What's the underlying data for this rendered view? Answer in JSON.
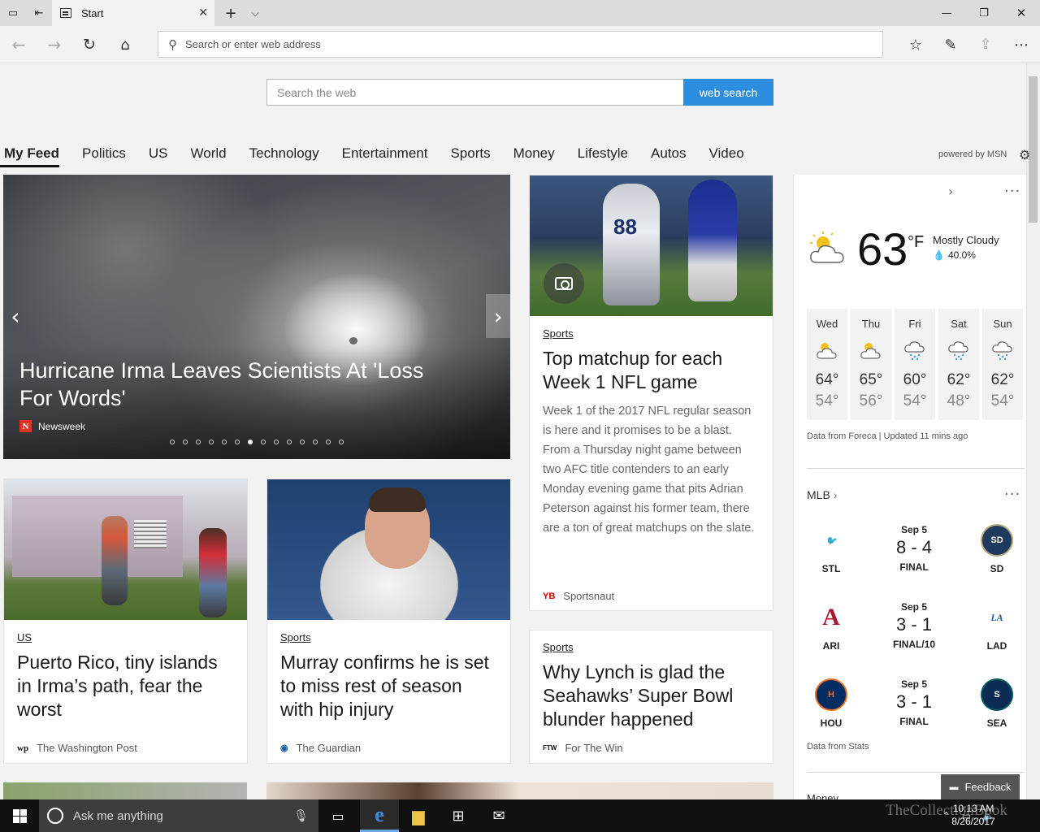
{
  "browser": {
    "tab_title": "Start",
    "address_placeholder": "Search or enter web address"
  },
  "search": {
    "placeholder": "Search the web",
    "button_label": "web search"
  },
  "categories": [
    "My Feed",
    "Politics",
    "US",
    "World",
    "Technology",
    "Entertainment",
    "Sports",
    "Money",
    "Lifestyle",
    "Autos",
    "Video"
  ],
  "powered_by": "powered by MSN",
  "hero": {
    "title": "Hurricane Irma Leaves Scientists At 'Loss For Words'",
    "source": "Newsweek",
    "slide_count": 14,
    "active_slide": 7
  },
  "cards": {
    "nfl": {
      "label": "Sports",
      "title": "Top matchup for each Week 1 NFL game",
      "body": "Week 1 of the 2017 NFL regular season is here and it promises to be a blast. From a Thursday night game between two AFC title contenders to an early Monday evening game that pits Adrian Peterson against his former team, there are a ton of great matchups on the slate.",
      "source": "Sportsnaut"
    },
    "puerto_rico": {
      "label": "US",
      "title": "Puerto Rico, tiny islands in Irma’s path, fear the worst",
      "source": "The Washington Post"
    },
    "murray": {
      "label": "Sports",
      "title": "Murray confirms he is set to miss rest of season with hip injury",
      "source": "The Guardian"
    },
    "lynch": {
      "label": "Sports",
      "title": "Why Lynch is glad the Seahawks’ Super Bowl blunder happened",
      "source": "For The Win"
    }
  },
  "weather": {
    "temp": "63",
    "unit": "°F",
    "condition": "Mostly Cloudy",
    "precip": "40.0%",
    "forecast": [
      {
        "day": "Wed",
        "hi": "64°",
        "lo": "54°",
        "icon": "partly-cloudy-icon"
      },
      {
        "day": "Thu",
        "hi": "65°",
        "lo": "56°",
        "icon": "partly-cloudy-icon"
      },
      {
        "day": "Fri",
        "hi": "60°",
        "lo": "54°",
        "icon": "rain-icon"
      },
      {
        "day": "Sat",
        "hi": "62°",
        "lo": "48°",
        "icon": "rain-icon"
      },
      {
        "day": "Sun",
        "hi": "62°",
        "lo": "54°",
        "icon": "rain-icon"
      }
    ],
    "footer": "Data from Foreca | Updated 11 mins ago"
  },
  "mlb": {
    "title": "MLB",
    "games": [
      {
        "date": "Sep 5",
        "score": "8 - 4",
        "status": "FINAL",
        "away": "STL",
        "home": "SD"
      },
      {
        "date": "Sep 5",
        "score": "3 - 1",
        "status": "FINAL/10",
        "away": "ARI",
        "home": "LAD"
      },
      {
        "date": "Sep 5",
        "score": "3 - 1",
        "status": "FINAL",
        "away": "HOU",
        "home": "SEA"
      }
    ],
    "footer": "Data from Stats",
    "next_section": "Money"
  },
  "feedback_label": "Feedback",
  "taskbar": {
    "search_placeholder": "Ask me anything",
    "time": "10:13 AM",
    "date": "8/26/2017",
    "watermark": "TheCollectionBook"
  },
  "colors": {
    "accent": "#2d8ee0",
    "taskbar": "#101010"
  }
}
